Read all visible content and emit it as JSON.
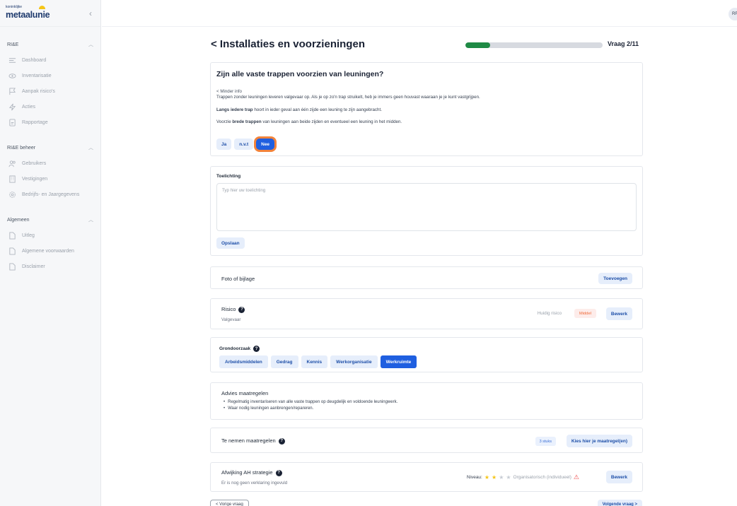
{
  "brand": {
    "logo_small": "koninklijke",
    "logo_main": "metaalunie"
  },
  "sidebar": {
    "sections": [
      {
        "title": "RI&E",
        "items": [
          {
            "label": "Dashboard",
            "icon": "list-icon"
          },
          {
            "label": "Inventarisatie",
            "icon": "eye-icon"
          },
          {
            "label": "Aanpak risico's",
            "icon": "flag-icon"
          },
          {
            "label": "Acties",
            "icon": "bolt-icon"
          },
          {
            "label": "Rapportage",
            "icon": "document-icon"
          }
        ]
      },
      {
        "title": "RI&E beheer",
        "items": [
          {
            "label": "Gebruikers",
            "icon": "users-icon"
          },
          {
            "label": "Vestigingen",
            "icon": "building-icon"
          },
          {
            "label": "Bedrijfs- en Jaargegevens",
            "icon": "gear-icon"
          }
        ]
      },
      {
        "title": "Algemeen",
        "items": [
          {
            "label": "Uitleg",
            "icon": "file-icon"
          },
          {
            "label": "Algemene voorwaarden",
            "icon": "file-icon"
          },
          {
            "label": "Disclaimer",
            "icon": "file-icon"
          }
        ]
      }
    ]
  },
  "user": {
    "initials": "RF"
  },
  "header": {
    "title": "< Installaties en voorzieningen",
    "progress": 0.18,
    "progress_label": "Vraag 2/11"
  },
  "question": {
    "title": "Zijn alle vaste trappen voorzien van leuningen?",
    "toggle": "< Minder info",
    "line1": "Trappen zonder leuningen leveren valgevaar op. Als je op zo'n trap struikelt, heb je immers geen houvast waaraan je je kunt vastgrijpen.",
    "line2_bold": "Langs iedere trap",
    "line2_rest": " hoort in ieder geval aan één zijde een leuning te zijn aangebracht.",
    "line3_pre": "Voorzie ",
    "line3_bold": "brede trappen",
    "line3_rest": " van leuningen aan beide zijden en eventueel een leuning in het midden.",
    "answers": [
      "Ja",
      "n.v.t",
      "Nee"
    ],
    "selected": "Nee"
  },
  "toelichting": {
    "label": "Toelichting",
    "placeholder": "Typ hier uw toelichting",
    "save": "Opslaan"
  },
  "foto": {
    "label": "Foto of bijlage",
    "button": "Toevoegen"
  },
  "risico": {
    "label": "Risico",
    "sub": "Valgevaar",
    "current_label": "Huidig risico",
    "level": "Middel",
    "button": "Bewerk"
  },
  "grondoorzaak": {
    "label": "Grondoorzaak",
    "options": [
      "Arbeidsmiddelen",
      "Gedrag",
      "Kennis",
      "Werkorganisatie",
      "Werkruimte"
    ],
    "selected": "Werkruimte"
  },
  "advies": {
    "label": "Advies maatregelen",
    "items": [
      "Regelmatig inventariseren van alle vaste trappen op deugdelijk en voldoende leuningwerk.",
      "Waar nodig leuningen aanbrengen/repareren."
    ]
  },
  "maatregelen": {
    "label": "Te nemen maatregelen",
    "count": "3 stuks",
    "button": "Kies hier je maatregel(en)"
  },
  "afwijking": {
    "label": "Afwijking AH strategie",
    "sub": "Er is nog geen verklaring ingevuld",
    "niveau_label": "Niveau:",
    "stars_on": 2,
    "stars_total": 4,
    "niveau_text": "Organisatorisch (individueel)",
    "button": "Bewerk"
  },
  "footer": {
    "prev": "< Vorige vraag",
    "next": "Volgende vraag >"
  },
  "colors": {
    "primary": "#1f5fe0",
    "progress": "#1f8a45",
    "highlight": "#f2833b",
    "brand": "#1e3a6d"
  }
}
